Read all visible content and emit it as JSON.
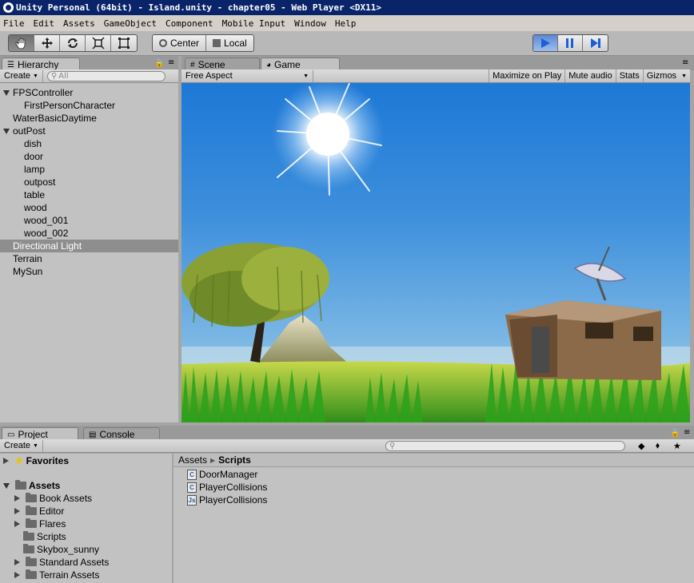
{
  "window": {
    "title": "Unity Personal (64bit) - Island.unity - chapter05 - Web Player <DX11>"
  },
  "menu": [
    "File",
    "Edit",
    "Assets",
    "GameObject",
    "Component",
    "Mobile Input",
    "Window",
    "Help"
  ],
  "toolbar": {
    "tools": [
      "hand-icon",
      "move-icon",
      "rotate-icon",
      "scale-icon",
      "rect-icon"
    ],
    "pivot_label": "Center",
    "space_label": "Local",
    "play_state": "playing"
  },
  "hierarchy": {
    "tab_label": "Hierarchy",
    "create_label": "Create",
    "search_placeholder": "All",
    "items": [
      {
        "label": "FPSController",
        "depth": 0,
        "expanded": true
      },
      {
        "label": "FirstPersonCharacter",
        "depth": 1
      },
      {
        "label": "WaterBasicDaytime",
        "depth": 0
      },
      {
        "label": "outPost",
        "depth": 0,
        "expanded": true
      },
      {
        "label": "dish",
        "depth": 1
      },
      {
        "label": "door",
        "depth": 1
      },
      {
        "label": "lamp",
        "depth": 1
      },
      {
        "label": "outpost",
        "depth": 1
      },
      {
        "label": "table",
        "depth": 1
      },
      {
        "label": "wood",
        "depth": 1
      },
      {
        "label": "wood_001",
        "depth": 1
      },
      {
        "label": "wood_002",
        "depth": 1
      },
      {
        "label": "Directional Light",
        "depth": 0,
        "selected": true
      },
      {
        "label": "Terrain",
        "depth": 0
      },
      {
        "label": "MySun",
        "depth": 0
      }
    ]
  },
  "scene_tab": "Scene",
  "game": {
    "tab_label": "Game",
    "aspect_label": "Free Aspect",
    "maximize_label": "Maximize on Play",
    "mute_label": "Mute audio",
    "stats_label": "Stats",
    "gizmos_label": "Gizmos"
  },
  "project": {
    "tab_label": "Project",
    "console_label": "Console",
    "create_label": "Create",
    "favorites_label": "Favorites",
    "assets_label": "Assets",
    "folders": [
      "Book Assets",
      "Editor",
      "Flares",
      "Scripts",
      "Skybox_sunny",
      "Standard Assets",
      "Terrain Assets"
    ],
    "breadcrumb": [
      "Assets",
      "Scripts"
    ],
    "files": [
      {
        "name": "DoorManager",
        "type": "C#"
      },
      {
        "name": "PlayerCollisions",
        "type": "C#"
      },
      {
        "name": "PlayerCollisions",
        "type": "JS"
      }
    ]
  }
}
